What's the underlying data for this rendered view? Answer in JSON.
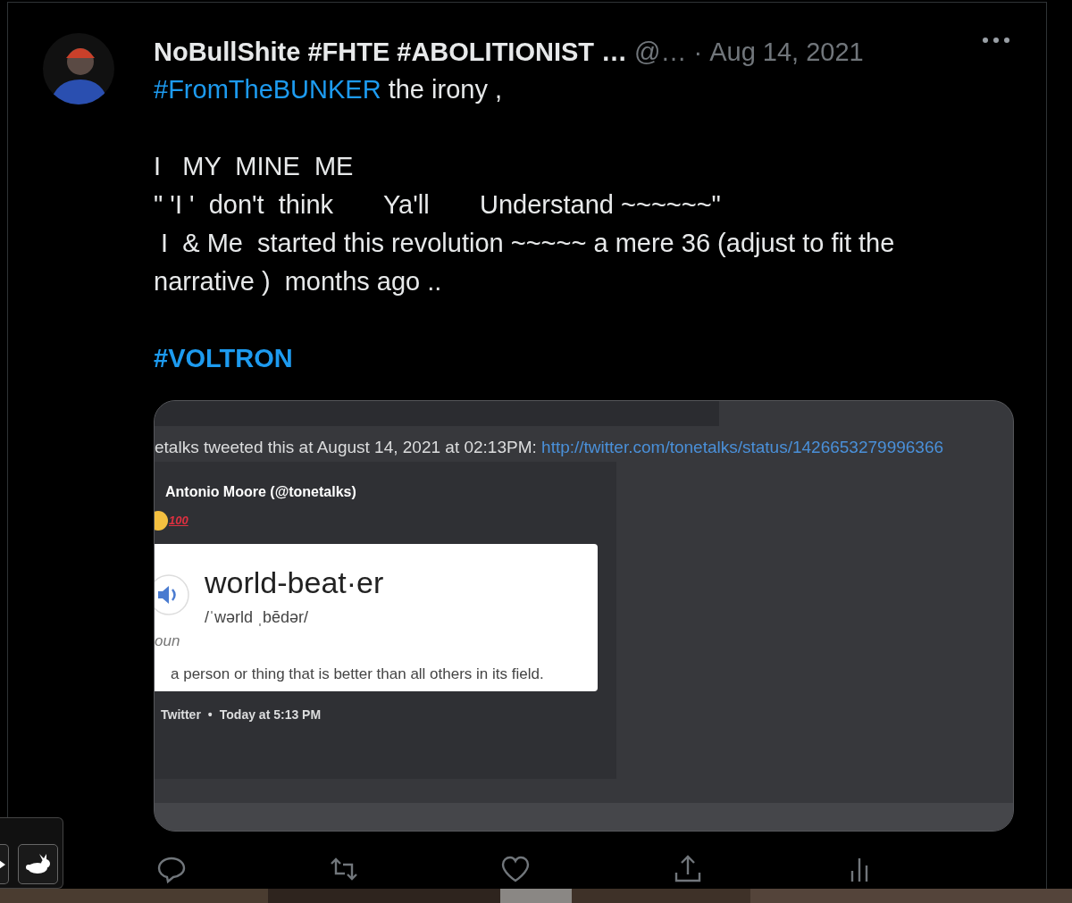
{
  "tweet": {
    "author_name": "NoBullShite #FHTE #ABOLITIONIST …",
    "handle": "@…",
    "separator": "·",
    "date": "Aug 14, 2021",
    "lines": [
      {
        "kind": "hashtag_line",
        "hashtag": "#FromTheBUNKER",
        "text": " the irony ,"
      },
      {
        "kind": "blank"
      },
      {
        "kind": "text",
        "text": "I   MY  MINE  ME"
      },
      {
        "kind": "text",
        "text": "\" 'I '  don't  think       Ya'll       Understand ~~~~~~\""
      },
      {
        "kind": "text",
        "text": " I  & Me  started this revolution ~~~~~ a mere 36 (adjust to fit the narrative )  months ago .."
      },
      {
        "kind": "blank"
      },
      {
        "kind": "hashtag",
        "hashtag": "#VOLTRON"
      }
    ],
    "embed": {
      "tweeted_line": "etalks tweeted this at August 14, 2021 at 02:13PM:",
      "link": "http://twitter.com/tonetalks/status/1426653279996366",
      "author": "Antonio Moore (@tonetalks)",
      "emoji_text": "100",
      "card": {
        "word": "world-beat·er",
        "pronunciation": "/ˈwərld ˌbēdər/",
        "part_of_speech": "oun",
        "definition": "a person or thing that is better than all others in its field."
      },
      "footer_source": "Twitter",
      "footer_dot": "•",
      "footer_time": "Today at 5:13 PM"
    },
    "actions": [
      {
        "kind": "reply"
      },
      {
        "kind": "retweet"
      },
      {
        "kind": "like"
      },
      {
        "kind": "share"
      },
      {
        "kind": "analytics"
      }
    ]
  },
  "widget": {
    "buttons": [
      {
        "kind": "play"
      },
      {
        "kind": "rabbit"
      }
    ]
  }
}
